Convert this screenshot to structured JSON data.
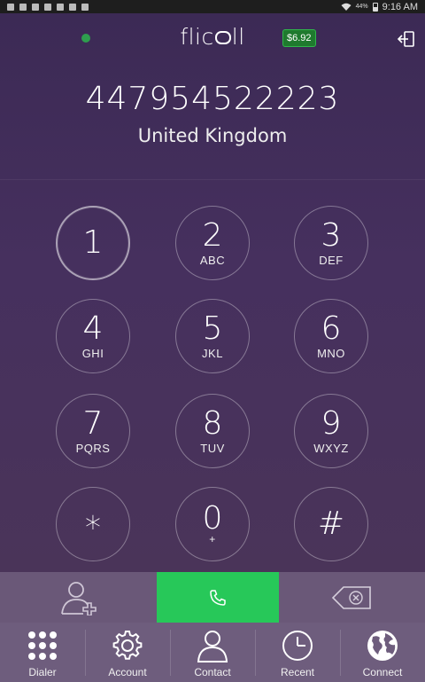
{
  "status_bar": {
    "battery": "44%",
    "time": "9:16 AM"
  },
  "header": {
    "logo_text_left": "flic",
    "logo_text_right": "ll",
    "balance": "$6.92"
  },
  "display": {
    "number": "447954522223",
    "country": "United Kingdom"
  },
  "keypad": {
    "keys": [
      {
        "digit": "1",
        "letters": ""
      },
      {
        "digit": "2",
        "letters": "ABC"
      },
      {
        "digit": "3",
        "letters": "DEF"
      },
      {
        "digit": "4",
        "letters": "GHI"
      },
      {
        "digit": "5",
        "letters": "JKL"
      },
      {
        "digit": "6",
        "letters": "MNO"
      },
      {
        "digit": "7",
        "letters": "PQRS"
      },
      {
        "digit": "8",
        "letters": "TUV"
      },
      {
        "digit": "9",
        "letters": "WXYZ"
      },
      {
        "digit": "*",
        "letters": ""
      },
      {
        "digit": "0",
        "letters": "+"
      },
      {
        "digit": "#",
        "letters": ""
      }
    ]
  },
  "nav": {
    "items": [
      {
        "label": "Dialer",
        "icon": "grid-icon"
      },
      {
        "label": "Account",
        "icon": "gear-icon"
      },
      {
        "label": "Contact",
        "icon": "person-icon"
      },
      {
        "label": "Recent",
        "icon": "clock-icon"
      },
      {
        "label": "Connect",
        "icon": "globe-icon"
      }
    ]
  },
  "colors": {
    "call_green": "#27c859",
    "balance_green": "#1f7a2e",
    "online_dot": "#2e9e4e"
  }
}
